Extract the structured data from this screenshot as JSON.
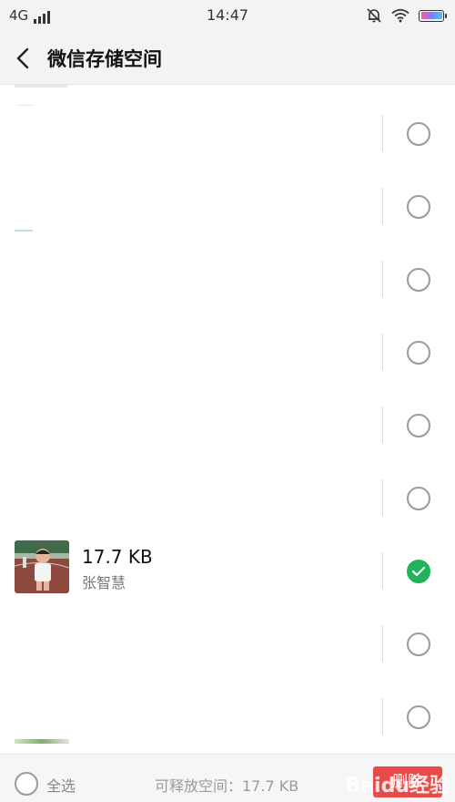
{
  "status_bar": {
    "network": "4G",
    "time": "14:47"
  },
  "header": {
    "title": "微信存储空间"
  },
  "rows": [
    {
      "checked": false
    },
    {
      "checked": false
    },
    {
      "checked": false
    },
    {
      "checked": false
    },
    {
      "checked": false
    },
    {
      "checked": false
    },
    {
      "checked": true,
      "size": "17.7 KB",
      "name": "张智慧"
    },
    {
      "checked": false
    },
    {
      "checked": false
    }
  ],
  "bottom_bar": {
    "select_all_label": "全选",
    "release_text": "可释放空间：17.7 KB",
    "delete_label": "删除"
  },
  "watermark": "Baidu经验",
  "colors": {
    "accent_green": "#22b35a",
    "delete_red": "#e84a4a"
  }
}
